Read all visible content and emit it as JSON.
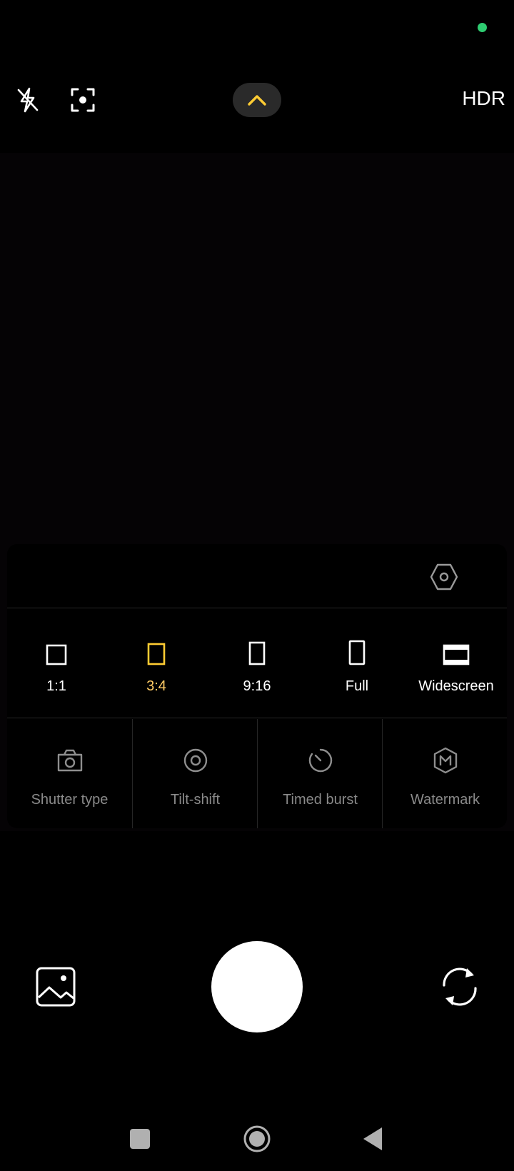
{
  "colors": {
    "accent": "#ffcc33",
    "active_label": "#ffcc66",
    "status_dot": "#2ecc71",
    "text": "#ffffff",
    "muted": "#8a8a8a",
    "icon": "#ffffff",
    "tool_icon": "#8e8e8e",
    "nav_icon": "#b0b0b0"
  },
  "status": {
    "indicator_icon": "green-dot-icon"
  },
  "top_bar": {
    "flash_icon": "flash-off-icon",
    "focus_icon": "scan-focus-icon",
    "expand_icon": "chevron-up-icon",
    "hdr_label": "HDR"
  },
  "panel": {
    "settings_icon": "hexagon-settings-icon",
    "aspect_ratios": [
      {
        "label": "1:1",
        "icon": "square-icon",
        "active": false
      },
      {
        "label": "3:4",
        "icon": "portrait-rect-icon",
        "active": true
      },
      {
        "label": "9:16",
        "icon": "tall-rect-icon",
        "active": false
      },
      {
        "label": "Full",
        "icon": "full-rect-icon",
        "active": false
      },
      {
        "label": "Widescreen",
        "icon": "widescreen-icon",
        "active": false
      }
    ],
    "tools": [
      {
        "label": "Shutter type",
        "icon": "camera-icon"
      },
      {
        "label": "Tilt-shift",
        "icon": "tilt-shift-icon"
      },
      {
        "label": "Timed burst",
        "icon": "timer-icon"
      },
      {
        "label": "Watermark",
        "icon": "watermark-m-icon"
      }
    ]
  },
  "bottom_controls": {
    "gallery_icon": "gallery-icon",
    "shutter": "shutter-button",
    "flip_icon": "flip-camera-icon"
  },
  "nav_bar": {
    "recents_icon": "square-nav-icon",
    "home_icon": "circle-nav-icon",
    "back_icon": "triangle-back-icon"
  }
}
